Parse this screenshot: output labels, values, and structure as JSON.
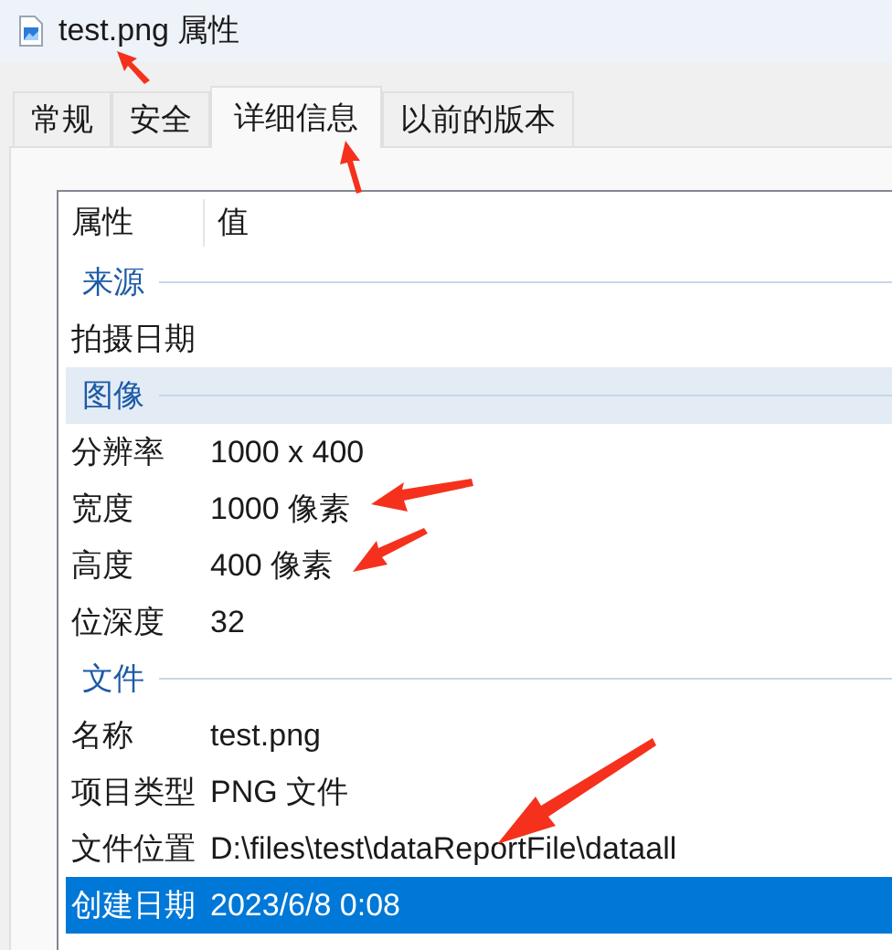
{
  "window": {
    "title": "test.png 属性"
  },
  "tabs": [
    {
      "label": "常规",
      "selected": false
    },
    {
      "label": "安全",
      "selected": false
    },
    {
      "label": "详细信息",
      "selected": true
    },
    {
      "label": "以前的版本",
      "selected": false
    }
  ],
  "list": {
    "columns": [
      "属性",
      "值"
    ],
    "groups": [
      {
        "title": "来源",
        "highlighted": false,
        "rows": [
          {
            "property": "拍摄日期",
            "selected": false
          }
        ]
      },
      {
        "title": "图像",
        "highlighted": true,
        "rows": [
          {
            "property": "分辨率",
            "value": "1000 x 400",
            "selected": false
          },
          {
            "property": "宽度",
            "value": "1000 像素",
            "selected": false
          },
          {
            "property": "高度",
            "value": "400 像素",
            "selected": false
          },
          {
            "property": "位深度",
            "value": "32",
            "selected": false
          }
        ]
      },
      {
        "title": "文件",
        "highlighted": false,
        "rows": [
          {
            "property": "名称",
            "value": "test.png",
            "selected": false
          },
          {
            "property": "项目类型",
            "value": "PNG 文件",
            "selected": false
          },
          {
            "property": "文件位置",
            "value": "D:\\files\\test\\dataReportFile\\dataall",
            "selected": false
          },
          {
            "property": "创建日期",
            "value": "2023/6/8 0:08",
            "selected": true
          }
        ]
      }
    ]
  }
}
